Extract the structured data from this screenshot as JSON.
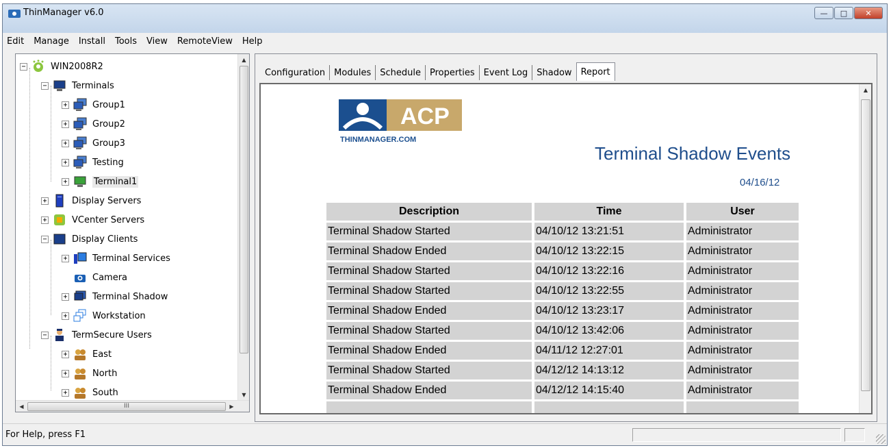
{
  "window": {
    "title": "ThinManager v6.0",
    "minimize": "—",
    "maximize": "□",
    "close": "✕"
  },
  "menu": [
    "Edit",
    "Manage",
    "Install",
    "Tools",
    "View",
    "RemoteView",
    "Help"
  ],
  "tree": {
    "root": "WIN2008R2",
    "terminals": "Terminals",
    "group1": "Group1",
    "group2": "Group2",
    "group3": "Group3",
    "testing": "Testing",
    "terminal1": "Terminal1",
    "display_servers": "Display Servers",
    "vcenter_servers": "VCenter Servers",
    "display_clients": "Display Clients",
    "terminal_services": "Terminal Services",
    "camera": "Camera",
    "terminal_shadow": "Terminal Shadow",
    "workstation": "Workstation",
    "termsecure_users": "TermSecure Users",
    "east": "East",
    "north": "North",
    "south": "South",
    "hscroll_grip": "III"
  },
  "tabs": [
    "Configuration",
    "Modules",
    "Schedule",
    "Properties",
    "Event Log",
    "Shadow",
    "Report"
  ],
  "report": {
    "logo_text": "ACP",
    "logo_sub": "THINMANAGER.COM",
    "title": "Terminal Shadow Events",
    "date": "04/16/12",
    "columns": {
      "description": "Description",
      "time": "Time",
      "user": "User"
    },
    "rows": [
      {
        "description": "Terminal Shadow Started",
        "time": "04/10/12 13:21:51",
        "user": "Administrator"
      },
      {
        "description": "Terminal Shadow Ended",
        "time": "04/10/12 13:22:15",
        "user": "Administrator"
      },
      {
        "description": "Terminal Shadow Started",
        "time": "04/10/12 13:22:16",
        "user": "Administrator"
      },
      {
        "description": "Terminal Shadow Started",
        "time": "04/10/12 13:22:55",
        "user": "Administrator"
      },
      {
        "description": "Terminal Shadow Ended",
        "time": "04/10/12 13:23:17",
        "user": "Administrator"
      },
      {
        "description": "Terminal Shadow Started",
        "time": "04/10/12 13:42:06",
        "user": "Administrator"
      },
      {
        "description": "Terminal Shadow Ended",
        "time": "04/11/12 12:27:01",
        "user": "Administrator"
      },
      {
        "description": "Terminal Shadow Started",
        "time": "04/12/12 14:13:12",
        "user": "Administrator"
      },
      {
        "description": "Terminal Shadow Ended",
        "time": "04/12/12 14:15:40",
        "user": "Administrator"
      }
    ]
  },
  "status": {
    "help_text": "For Help, press F1"
  },
  "colors": {
    "report_title": "#1f4e8c",
    "table_cell": "#d3d3d3",
    "logo_blue": "#1b4f8f",
    "logo_tan": "#c8a86b"
  }
}
